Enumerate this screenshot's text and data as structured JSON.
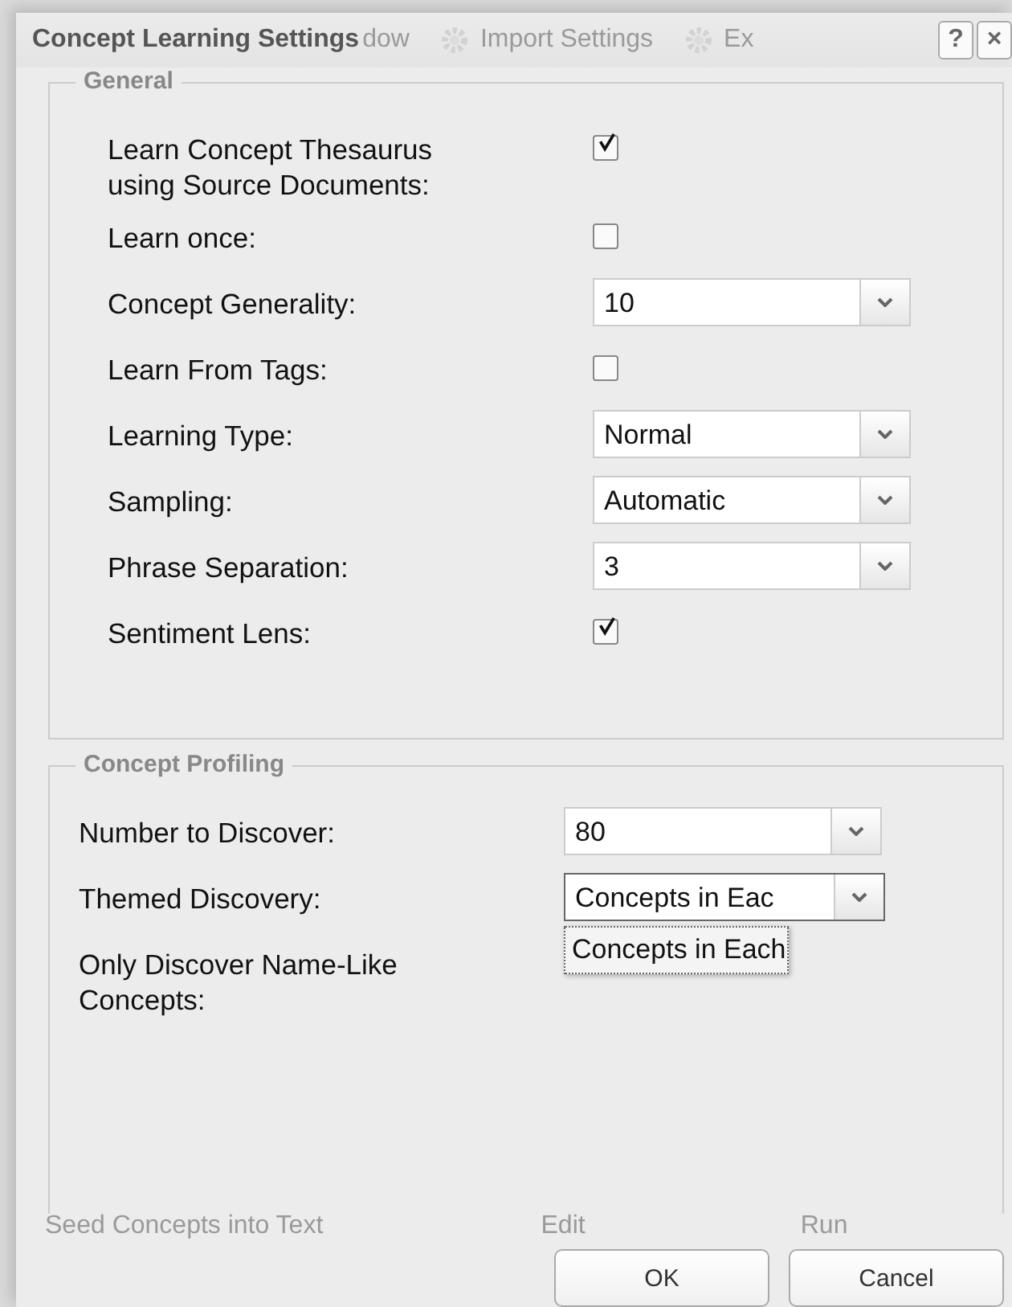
{
  "window": {
    "title": "Concept Learning Settings",
    "help": "?",
    "close": "×"
  },
  "background": {
    "toolbar": [
      "dow",
      "Import Settings",
      "Ex"
    ],
    "caption": "Seed Concepts into Text",
    "buttons": [
      "Edit",
      "Run"
    ]
  },
  "general": {
    "title": "General",
    "rows": [
      {
        "label": "Learn Concept Thesaurus using Source Documents:",
        "kind": "checkbox",
        "checked": true
      },
      {
        "label": "Learn once:",
        "kind": "checkbox",
        "checked": false
      },
      {
        "label": "Concept Generality:",
        "kind": "select",
        "value": "10",
        "expanded": false
      },
      {
        "label": "Learn From Tags:",
        "kind": "checkbox",
        "checked": false
      },
      {
        "label": "Learning Type:",
        "kind": "select",
        "value": "Normal",
        "expanded": false
      },
      {
        "label": "Sampling:",
        "kind": "select",
        "value": "Automatic",
        "expanded": false
      },
      {
        "label": "Phrase Separation:",
        "kind": "select",
        "value": "3",
        "expanded": false
      },
      {
        "label": "Sentiment Lens:",
        "kind": "checkbox",
        "checked": true
      }
    ]
  },
  "profiling": {
    "title": "Concept Profiling",
    "rows": [
      {
        "label": "Number to Discover:",
        "kind": "select",
        "value": "80",
        "expanded": false
      },
      {
        "label": "Themed Discovery:",
        "kind": "select",
        "value": "Concepts in Eac",
        "expanded": true,
        "options": [
          "Concepts in Each"
        ]
      },
      {
        "label": "Only Discover Name-Like Concepts:"
      }
    ]
  },
  "buttons": [
    "OK",
    "Cancel"
  ]
}
